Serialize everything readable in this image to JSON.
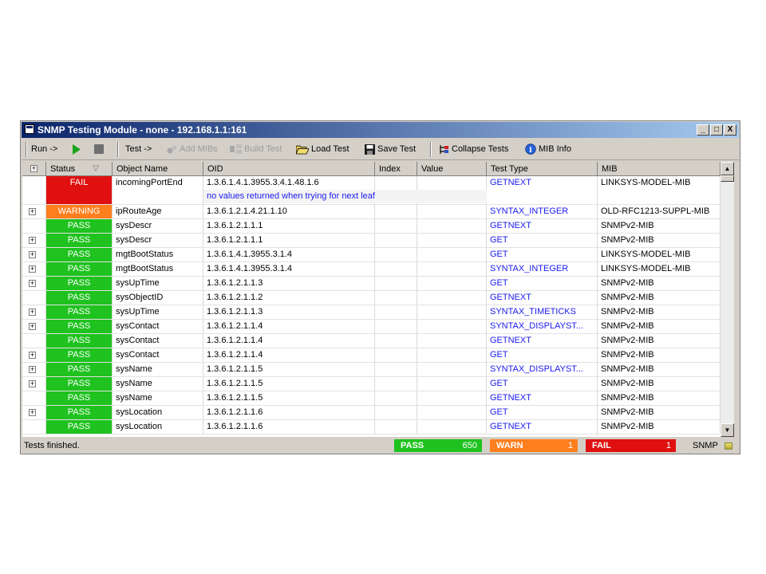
{
  "window": {
    "title": "SNMP Testing Module - none - 192.168.1.1:161",
    "controls": [
      "_",
      "□",
      "X"
    ]
  },
  "toolbar": {
    "run": "Run ->",
    "test": "Test ->",
    "add_mibs": "Add MIBs",
    "build_test": "Build Test",
    "load_test": "Load Test",
    "save_test": "Save Test",
    "collapse_tests": "Collapse Tests",
    "mib_info": "MIB Info"
  },
  "columns": [
    "Status",
    "Object Name",
    "OID",
    "Index",
    "Value",
    "Test Type",
    "MIB"
  ],
  "sort_glyph": "▽",
  "rows": [
    {
      "status": "FAIL",
      "name": "incomingPortEnd",
      "oid": "1.3.6.1.4.1.3955.3.4.1.48.1.6",
      "index": "",
      "value": "",
      "type": "GETNEXT",
      "mib": "LINKSYS-MODEL-MIB",
      "expand": false
    },
    {
      "status": "WARNING",
      "name": "ipRouteAge",
      "oid": "1.3.6.1.2.1.4.21.1.10",
      "index": "",
      "value": "",
      "type": "SYNTAX_INTEGER",
      "mib": "OLD-RFC1213-SUPPL-MIB",
      "expand": true
    },
    {
      "status": "PASS",
      "name": "sysDescr",
      "oid": "1.3.6.1.2.1.1.1",
      "index": "",
      "value": "",
      "type": "GETNEXT",
      "mib": "SNMPv2-MIB",
      "expand": false
    },
    {
      "status": "PASS",
      "name": "sysDescr",
      "oid": "1.3.6.1.2.1.1.1",
      "index": "",
      "value": "",
      "type": "GET",
      "mib": "SNMPv2-MIB",
      "expand": true
    },
    {
      "status": "PASS",
      "name": "mgtBootStatus",
      "oid": "1.3.6.1.4.1.3955.3.1.4",
      "index": "",
      "value": "",
      "type": "GET",
      "mib": "LINKSYS-MODEL-MIB",
      "expand": true
    },
    {
      "status": "PASS",
      "name": "mgtBootStatus",
      "oid": "1.3.6.1.4.1.3955.3.1.4",
      "index": "",
      "value": "",
      "type": "SYNTAX_INTEGER",
      "mib": "LINKSYS-MODEL-MIB",
      "expand": true
    },
    {
      "status": "PASS",
      "name": "sysUpTime",
      "oid": "1.3.6.1.2.1.1.3",
      "index": "",
      "value": "",
      "type": "GET",
      "mib": "SNMPv2-MIB",
      "expand": true
    },
    {
      "status": "PASS",
      "name": "sysObjectID",
      "oid": "1.3.6.1.2.1.1.2",
      "index": "",
      "value": "",
      "type": "GETNEXT",
      "mib": "SNMPv2-MIB",
      "expand": false
    },
    {
      "status": "PASS",
      "name": "sysUpTime",
      "oid": "1.3.6.1.2.1.1.3",
      "index": "",
      "value": "",
      "type": "SYNTAX_TIMETICKS",
      "mib": "SNMPv2-MIB",
      "expand": true
    },
    {
      "status": "PASS",
      "name": "sysContact",
      "oid": "1.3.6.1.2.1.1.4",
      "index": "",
      "value": "",
      "type": "SYNTAX_DISPLAYST...",
      "mib": "SNMPv2-MIB",
      "expand": true
    },
    {
      "status": "PASS",
      "name": "sysContact",
      "oid": "1.3.6.1.2.1.1.4",
      "index": "",
      "value": "",
      "type": "GETNEXT",
      "mib": "SNMPv2-MIB",
      "expand": false
    },
    {
      "status": "PASS",
      "name": "sysContact",
      "oid": "1.3.6.1.2.1.1.4",
      "index": "",
      "value": "",
      "type": "GET",
      "mib": "SNMPv2-MIB",
      "expand": true
    },
    {
      "status": "PASS",
      "name": "sysName",
      "oid": "1.3.6.1.2.1.1.5",
      "index": "",
      "value": "",
      "type": "SYNTAX_DISPLAYST...",
      "mib": "SNMPv2-MIB",
      "expand": true
    },
    {
      "status": "PASS",
      "name": "sysName",
      "oid": "1.3.6.1.2.1.1.5",
      "index": "",
      "value": "",
      "type": "GET",
      "mib": "SNMPv2-MIB",
      "expand": true
    },
    {
      "status": "PASS",
      "name": "sysName",
      "oid": "1.3.6.1.2.1.1.5",
      "index": "",
      "value": "",
      "type": "GETNEXT",
      "mib": "SNMPv2-MIB",
      "expand": false
    },
    {
      "status": "PASS",
      "name": "sysLocation",
      "oid": "1.3.6.1.2.1.1.6",
      "index": "",
      "value": "",
      "type": "GET",
      "mib": "SNMPv2-MIB",
      "expand": true
    },
    {
      "status": "PASS",
      "name": "sysLocation",
      "oid": "1.3.6.1.2.1.1.6",
      "index": "",
      "value": "",
      "type": "GETNEXT",
      "mib": "SNMPv2-MIB",
      "expand": false
    }
  ],
  "fail_detail": "no values returned when trying for next leaf",
  "status_colors": {
    "PASS": "#1fc21f",
    "WARNING": "#ff7f1e",
    "FAIL": "#e01010"
  },
  "statusbar": {
    "message": "Tests finished.",
    "pass_label": "PASS",
    "pass_count": "650",
    "warn_label": "WARN",
    "warn_count": "1",
    "fail_label": "FAIL",
    "fail_count": "1",
    "protocol": "SNMP"
  },
  "icons": {
    "expand": "plus-box-icon",
    "run": "play-icon",
    "stop": "stop-icon"
  }
}
